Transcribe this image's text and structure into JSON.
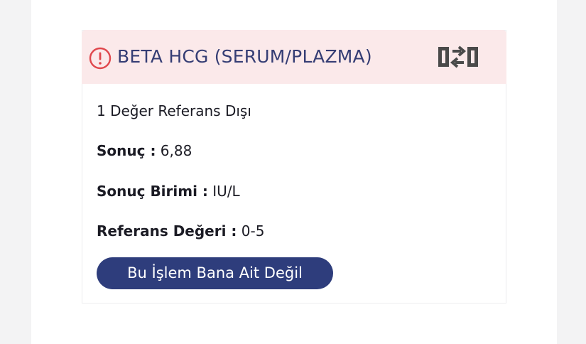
{
  "result_card": {
    "title": "BETA HCG (SERUM/PLAZMA)",
    "warning_icon": "alert-circle-icon",
    "switch_icon": "swap-icon",
    "summary": "1 Değer Referans Dışı",
    "result_label": "Sonuç :",
    "result_value": "6,88",
    "unit_label": "Sonuç Birimi :",
    "unit_value": "IU/L",
    "reference_label": "Referans Değeri :",
    "reference_value": "0-5",
    "action_button_label": "Bu İşlem Bana Ait Değil"
  },
  "colors": {
    "header_background": "#fbe9ea",
    "title_text": "#353d74",
    "warning_red": "#e0484d",
    "button_background": "#2e3d7c",
    "icon_gray": "#4a4a4a"
  }
}
